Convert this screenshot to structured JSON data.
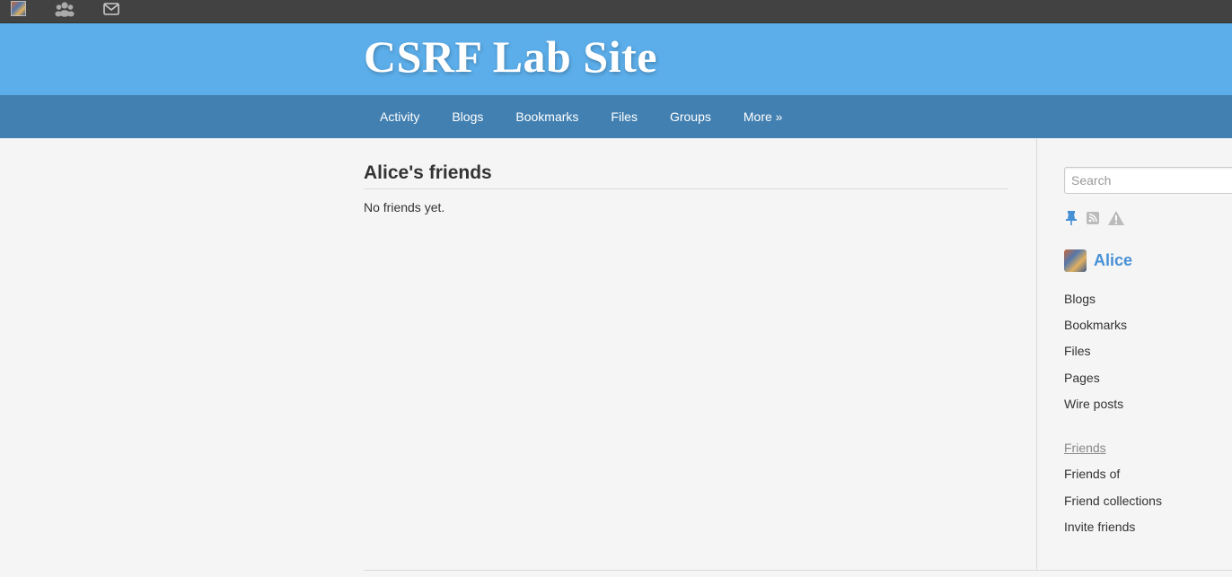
{
  "topbar": {
    "icons": [
      "avatar-icon",
      "friends-icon",
      "mail-icon"
    ]
  },
  "site": {
    "title": "CSRF Lab Site"
  },
  "nav": {
    "items": [
      {
        "label": "Activity"
      },
      {
        "label": "Blogs"
      },
      {
        "label": "Bookmarks"
      },
      {
        "label": "Files"
      },
      {
        "label": "Groups"
      },
      {
        "label": "More »"
      }
    ]
  },
  "main": {
    "title": "Alice's friends",
    "empty_message": "No friends yet."
  },
  "sidebar": {
    "search_placeholder": "Search",
    "extras_icons": [
      "pin-icon",
      "rss-icon",
      "report-icon"
    ],
    "owner_name": "Alice",
    "owner_menu": [
      {
        "label": "Blogs"
      },
      {
        "label": "Bookmarks"
      },
      {
        "label": "Files"
      },
      {
        "label": "Pages"
      },
      {
        "label": "Wire posts"
      }
    ],
    "friends_menu": [
      {
        "label": "Friends",
        "selected": true
      },
      {
        "label": "Friends of"
      },
      {
        "label": "Friend collections"
      },
      {
        "label": "Invite friends"
      }
    ]
  },
  "colors": {
    "topbar": "#424242",
    "header": "#5caeea",
    "nav": "#4280b1",
    "link": "#4690d6"
  }
}
